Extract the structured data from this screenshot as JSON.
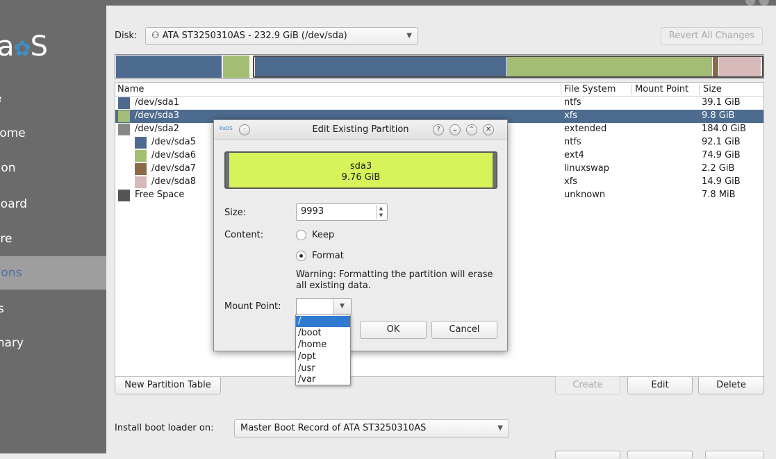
{
  "sidebar": {
    "logo": {
      "prefix": "a",
      "gear": "✿",
      "suffix": "S"
    },
    "items": [
      {
        "label": "e"
      },
      {
        "label": "come"
      },
      {
        "label": "tion"
      },
      {
        "label": "board"
      },
      {
        "label": "are"
      },
      {
        "label": "tions"
      },
      {
        "label": "rs"
      },
      {
        "label": "mary"
      }
    ]
  },
  "disk": {
    "label": "Disk:",
    "label_accel": "D",
    "selected": "ATA ST3250310AS - 232.9 GiB (/dev/sda)",
    "revert_label": "Revert All Changes"
  },
  "bar": {
    "colors": {
      "ntfs": "#4d6b8e",
      "xfs": "#a3bd74",
      "swap": "#8a6a48",
      "free": "#d7b9b9"
    }
  },
  "table": {
    "headers": {
      "name": "Name",
      "fs": "File System",
      "mount": "Mount Point",
      "size": "Size"
    },
    "rows": [
      {
        "name": "/dev/sda1",
        "fs": "ntfs",
        "size": "39.1 GiB",
        "color": "#4d6b8e"
      },
      {
        "name": "/dev/sda3",
        "fs": "xfs",
        "size": "9.8 GiB",
        "color": "#a3bd74"
      },
      {
        "name": "/dev/sda2",
        "fs": "extended",
        "size": "184.0 GiB",
        "color": "#888888"
      },
      {
        "name": "/dev/sda5",
        "fs": "ntfs",
        "size": "92.1 GiB",
        "color": "#4d6b8e"
      },
      {
        "name": "/dev/sda6",
        "fs": "ext4",
        "size": "74.9 GiB",
        "color": "#a3bd74"
      },
      {
        "name": "/dev/sda7",
        "fs": "linuxswap",
        "size": "2.2 GiB",
        "color": "#8a6a48"
      },
      {
        "name": "/dev/sda8",
        "fs": "xfs",
        "size": "14.9 GiB",
        "color": "#d7b9b9"
      },
      {
        "name": "Free Space",
        "fs": "unknown",
        "size": "7.8 MiB",
        "color": "#555555"
      }
    ]
  },
  "buttons": {
    "new_table": "New Partition Table",
    "create": "Create",
    "edit": "Edit",
    "delete": "Delete"
  },
  "bootloader": {
    "label": "Install boot loader on:",
    "selected": "Master Boot Record of ATA ST3250310AS"
  },
  "dialog": {
    "title": "Edit Existing Partition",
    "app_badge": "KaOS",
    "partition_name": "sda3",
    "partition_size": "9.76 GiB",
    "size_label": "Size:",
    "size_value": "9993",
    "content_label": "Content:",
    "keep_label": "Keep",
    "format_label": "Format",
    "warning": "Warning: Formatting the partition will erase all existing data.",
    "mount_label": "Mount Point:",
    "ok": "OK",
    "cancel": "Cancel",
    "fill_color": "#d7f35a"
  },
  "mount_options": [
    "/",
    "/boot",
    "/home",
    "/opt",
    "/usr",
    "/var"
  ]
}
